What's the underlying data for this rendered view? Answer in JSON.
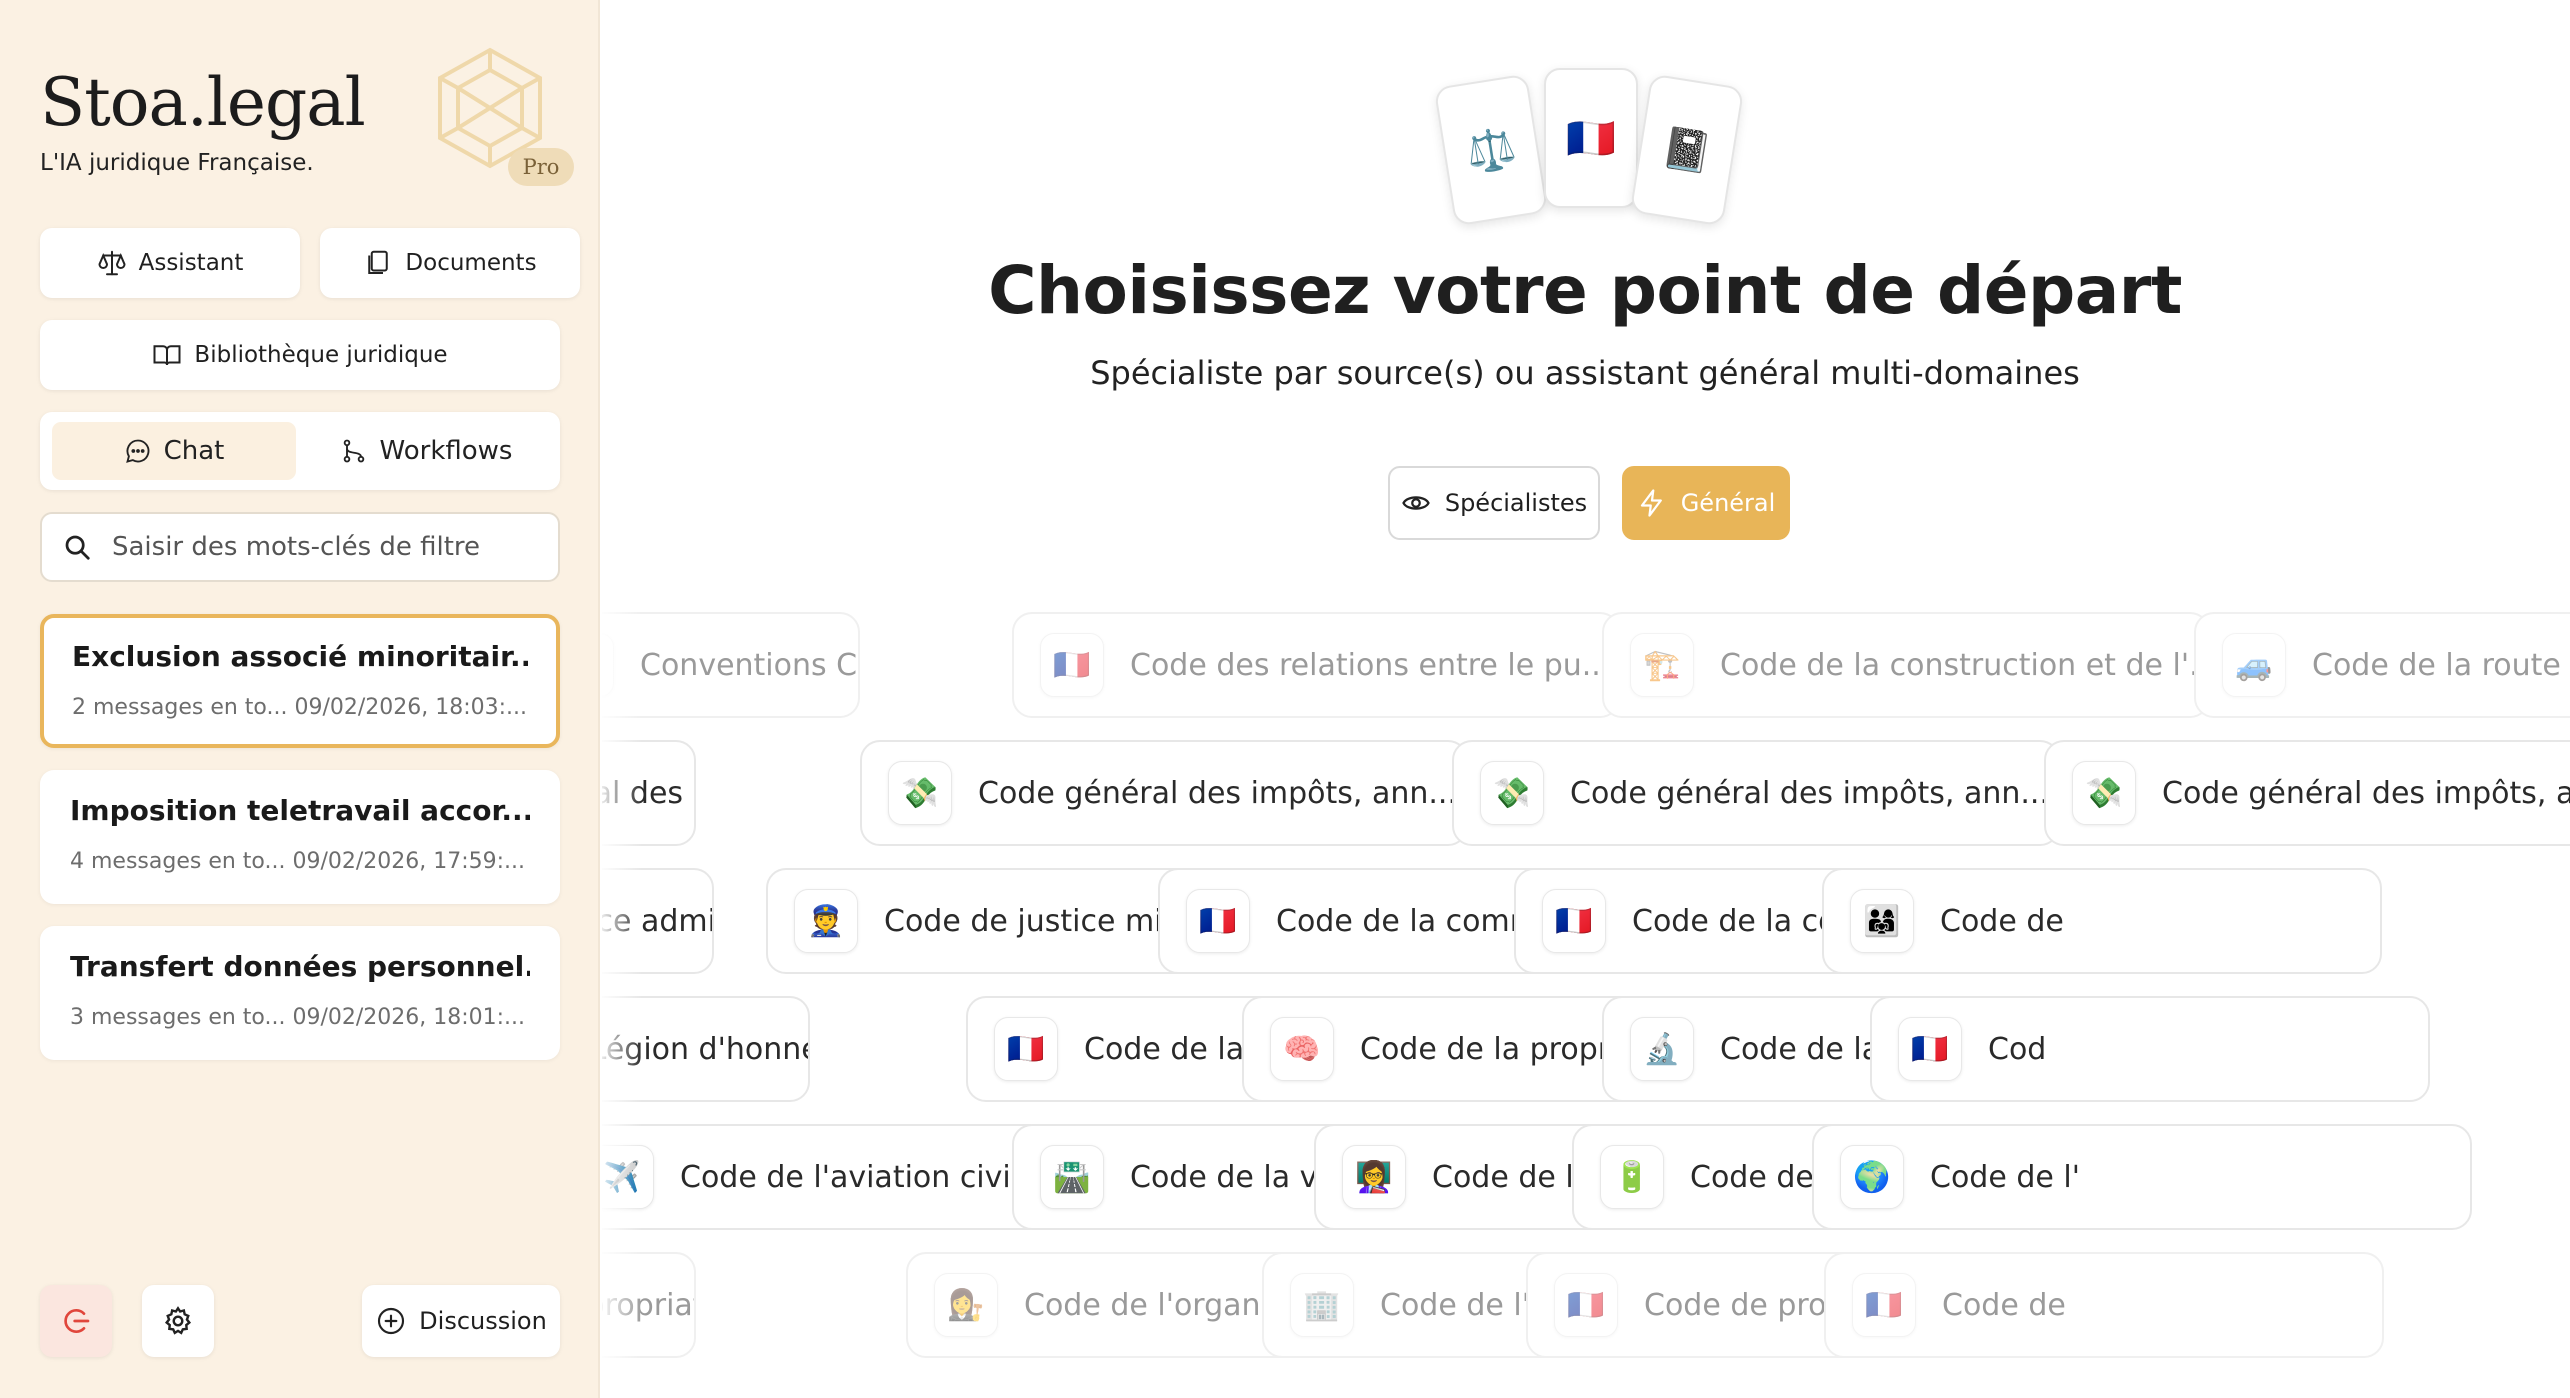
{
  "brand": {
    "title": "Stoa.legal",
    "subtitle": "L'IA juridique Française.",
    "badge": "Pro"
  },
  "sidebar": {
    "assistant_label": "Assistant",
    "documents_label": "Documents",
    "library_label": "Bibliothèque juridique",
    "tabs": {
      "chat": "Chat",
      "workflows": "Workflows",
      "active": "chat"
    },
    "search_placeholder": "Saisir des mots-clés de filtre",
    "conversations": [
      {
        "title": "Exclusion associé minoritair...",
        "meta": "2 messages en to... 09/02/2026, 18:03:...",
        "active": true
      },
      {
        "title": "Imposition teletravail accor...",
        "meta": "4 messages en to... 09/02/2026, 17:59:...",
        "active": false
      },
      {
        "title": "Transfert données personnel...",
        "meta": "3 messages en to... 09/02/2026, 18:01:...",
        "active": false
      }
    ],
    "discussion_label": "Discussion"
  },
  "main": {
    "card_icons": [
      "⚖️",
      "🇫🇷",
      "📓"
    ],
    "headline": "Choisissez votre point de départ",
    "subheadline": "Spécialiste par source(s) ou assistant général multi-domaines",
    "specialists_label": "Spécialistes",
    "general_label": "Général",
    "chip_rows": [
      [
        {
          "icon": "⚖️",
          "label": "Conventions Collectives"
        },
        {
          "icon": "🇫🇷",
          "label": "Code des relations entre le pu..."
        },
        {
          "icon": "🏗️",
          "label": "Code de la construction et de l'..."
        },
        {
          "icon": "🚙",
          "label": "Code de la route"
        }
      ],
      [
        {
          "icon": "💸",
          "label": "Code général des impôts anne..."
        },
        {
          "icon": "💸",
          "label": "Code général des impôts, ann..."
        },
        {
          "icon": "💸",
          "label": "Code général des impôts, ann..."
        },
        {
          "icon": "💸",
          "label": "Code général des impôts, ann..."
        }
      ],
      [
        {
          "icon": "🇫🇷",
          "label": "Code de justice administrative"
        },
        {
          "icon": "👮",
          "label": "Code de justice militaire"
        },
        {
          "icon": "🇫🇷",
          "label": "Code de la commande publique"
        },
        {
          "icon": "🇫🇷",
          "label": "Code de la consommation"
        },
        {
          "icon": "👨‍👩‍👧",
          "label": "Code de"
        }
      ],
      [
        {
          "icon": "🎖️",
          "label": "Code de la Légion d'honneur, d..."
        },
        {
          "icon": "🇫🇷",
          "label": "Code de la mutualité"
        },
        {
          "icon": "🧠",
          "label": "Code de la propriété intellectu..."
        },
        {
          "icon": "🔬",
          "label": "Code de la recherche"
        },
        {
          "icon": "🇫🇷",
          "label": "Cod"
        }
      ],
      [
        {
          "icon": "✈️",
          "label": "Code de l'aviation civile"
        },
        {
          "icon": "🛣️",
          "label": "Code de la voirie routière"
        },
        {
          "icon": "👩‍🏫",
          "label": "Code de l'éducation"
        },
        {
          "icon": "🔋",
          "label": "Code de l'énergie"
        },
        {
          "icon": "🌍",
          "label": "Code de l'"
        }
      ],
      [
        {
          "icon": "🇫🇷",
          "label": "Code de l'expropriation pour c..."
        },
        {
          "icon": "👩‍⚖️",
          "label": "Code de l'organisation judiciaire"
        },
        {
          "icon": "🏢",
          "label": "Code de l'urbanisme"
        },
        {
          "icon": "🇫🇷",
          "label": "Code de procédure civile"
        },
        {
          "icon": "🇫🇷",
          "label": "Code de"
        }
      ]
    ]
  },
  "colors": {
    "accent": "#e8b558",
    "sidebar_bg": "#fbf1e3",
    "active_border": "#e9b65c"
  }
}
